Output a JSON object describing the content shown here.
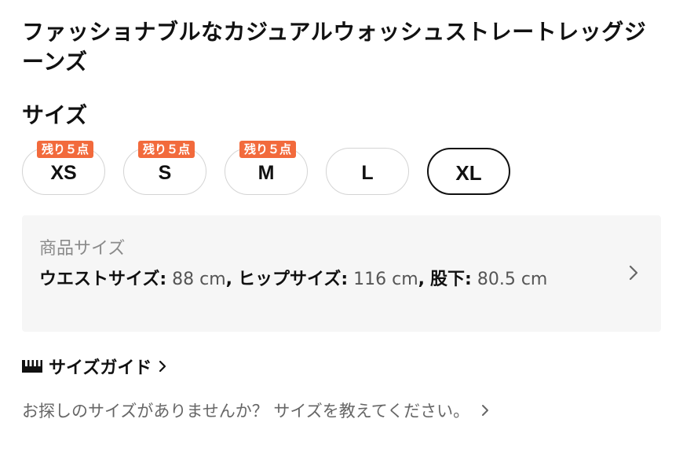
{
  "product": {
    "title": "ファッショナブルなカジュアルウォッシュストレートレッグジーンズ"
  },
  "size_selector": {
    "label": "サイズ",
    "options": [
      {
        "label": "XS",
        "badge": "残り５点",
        "selected": false
      },
      {
        "label": "S",
        "badge": "残り５点",
        "selected": false
      },
      {
        "label": "M",
        "badge": "残り５点",
        "selected": false
      },
      {
        "label": "L",
        "badge": "",
        "selected": false
      },
      {
        "label": "XL",
        "badge": "",
        "selected": true
      }
    ],
    "badge_color": "#f26a3c"
  },
  "measurements": {
    "heading": "商品サイズ",
    "items": [
      {
        "label": "ウエストサイズ:",
        "value": "88 cm"
      },
      {
        "label": "ヒップサイズ:",
        "value": "116 cm"
      },
      {
        "label": "股下:",
        "value": "80.5 cm"
      }
    ],
    "separator": ",",
    "chevron_icon": "chevron-right-icon"
  },
  "size_guide": {
    "label": "サイズガイド",
    "icon": "ruler-icon"
  },
  "help": {
    "text": "お探しのサイズがありませんか？ サイズを教えてください。"
  }
}
